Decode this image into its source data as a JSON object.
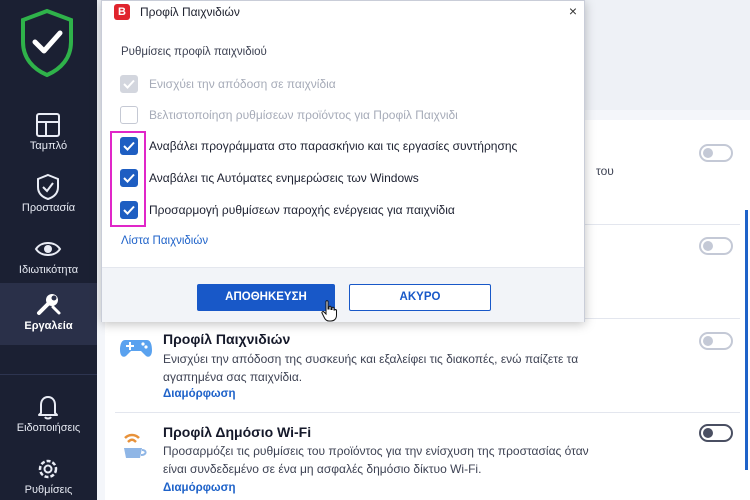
{
  "sidebar": {
    "items": [
      {
        "label": "Ταμπλό",
        "icon": "dashboard-icon"
      },
      {
        "label": "Προστασία",
        "icon": "shield-check-icon"
      },
      {
        "label": "Ιδιωτικότητα",
        "icon": "eye-icon"
      },
      {
        "label": "Εργαλεία",
        "icon": "tools-icon",
        "active": true
      },
      {
        "label": "Ειδοποιήσεις",
        "icon": "bell-icon"
      },
      {
        "label": "Ρυθμίσεις",
        "icon": "gear-icon"
      }
    ]
  },
  "dialog": {
    "app_badge": "B",
    "title": "Προφίλ Παιχνιδιών",
    "close": "×",
    "section_label": "Ρυθμίσεις προφίλ παιχνιδιού",
    "options": [
      {
        "label": "Ενισχύει την απόδοση σε παιχνίδια",
        "state": "disabled-checked"
      },
      {
        "label": "Βελτιστοποίηση ρυθμίσεων προϊόντος για Προφίλ Παιχνιδι",
        "state": "disabled-unchecked"
      },
      {
        "label": "Αναβάλει προγράμματα στο παρασκήνιο και τις εργασίες συντήρησης",
        "state": "checked"
      },
      {
        "label": "Αναβάλει τις Αυτόματες ενημερώσεις των Windows",
        "state": "checked"
      },
      {
        "label": "Προσαρμογή ρυθμίσεων παροχής ενέργειας για παιχνίδια",
        "state": "checked"
      }
    ],
    "games_link": "Λίστα Παιχνιδιών",
    "save_button": "ΑΠΟΘΗΚΕΥΣΗ",
    "cancel_button": "ΑΚΥΡΟ"
  },
  "background": {
    "cutoff_text": "του",
    "features": [
      {
        "title": "Προφίλ Παιχνιδιών",
        "desc_line1": "Ενισχύει την απόδοση της συσκευής και εξαλείφει τις διακοπές, ενώ παίζετε τα",
        "desc_line2": "αγαπημένα σας παιχνίδια.",
        "link": "Διαμόρφωση",
        "icon": "gamepad-icon",
        "toggle": "off"
      },
      {
        "title": "Προφίλ Δημόσιο Wi-Fi",
        "desc_line1": "Προσαρμόζει τις ρυθμίσεις του προϊόντος για την ενίσχυση της προστασίας όταν",
        "desc_line2": "είναι συνδεδεμένο σε ένα μη ασφαλές δημόσιο δίκτυο Wi-Fi.",
        "link": "Διαμόρφωση",
        "icon": "coffee-wifi-icon",
        "toggle": "off"
      }
    ]
  },
  "colors": {
    "sidebar_bg": "#1b2033",
    "shield_green": "#2fb24a",
    "accent_blue": "#1858c8",
    "highlight_magenta": "#e026c8",
    "brand_red": "#e0242d"
  }
}
